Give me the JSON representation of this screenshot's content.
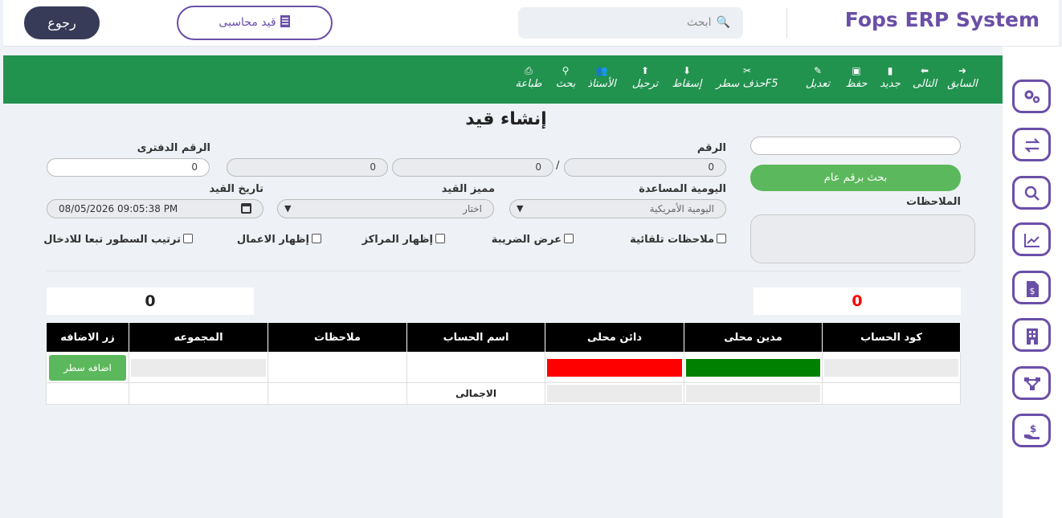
{
  "header": {
    "brand": "Fops ERP System",
    "search_placeholder": "ابحث",
    "search_icon": "magnifier-icon",
    "entry_button": "قيد محاسبى",
    "back_button": "رجوع"
  },
  "toolbar": [
    {
      "label": "السابق",
      "icon": "arrow-right-circle-icon"
    },
    {
      "label": "التالى",
      "icon": "arrow-left-circle-icon"
    },
    {
      "label": "جديد",
      "icon": "file-icon"
    },
    {
      "label": "حفظ",
      "icon": "save-icon"
    },
    {
      "label": "تعديل",
      "icon": "edit-icon"
    },
    {
      "label": "حذف سطرF5",
      "icon": "scissors-icon"
    },
    {
      "label": "إسقاط",
      "icon": "file-download-icon"
    },
    {
      "label": "ترحيل",
      "icon": "file-upload-icon"
    },
    {
      "label": "الأستاذ",
      "icon": "users-icon"
    },
    {
      "label": "بحث",
      "icon": "search-icon"
    },
    {
      "label": "طباعة",
      "icon": "print-icon"
    }
  ],
  "form": {
    "title": "إنشاء قيد",
    "number_label": "الرقم",
    "number_value": "0",
    "number_part2": "0",
    "number_part3": "0",
    "slash": "/",
    "book_number_label": "الرقم الدفترى",
    "book_number_value": "0",
    "search_general_button": "بحث برقم عام",
    "notes_label": "الملاحظات",
    "journal_label": "اليومية المساعدة",
    "journal_value": "اليومية الأمريكية",
    "distinguisher_label": "مميز القيد",
    "distinguisher_value": "اختار",
    "date_label": "تاريخ القيد",
    "date_value": "08/05/2026 09:05:38 PM"
  },
  "checkboxes": [
    "ملاحظات تلقائية",
    "عرض الضريبة",
    "إظهار المراكز",
    "إظهار الاعمال",
    "ترتيب السطور تبعا للادخال"
  ],
  "totals": {
    "right_value": "0",
    "right_color": "#ff0000",
    "left_value": "0"
  },
  "table": {
    "headers": [
      "كود الحساب",
      "مدين محلى",
      "دائن محلى",
      "اسم الحساب",
      "ملاحظات",
      "المجموعه",
      "زر الاضافه"
    ],
    "add_row_button": "اضافه سطر",
    "total_label": "الاجمالى",
    "debit_color": "#008000",
    "credit_color": "#ff0000"
  },
  "sidebar": [
    "settings-gears-icon",
    "transfer-arrows-icon",
    "search-icon",
    "chart-line-icon",
    "invoice-dollar-icon",
    "building-icon",
    "network-icon",
    "hand-dollar-icon"
  ]
}
